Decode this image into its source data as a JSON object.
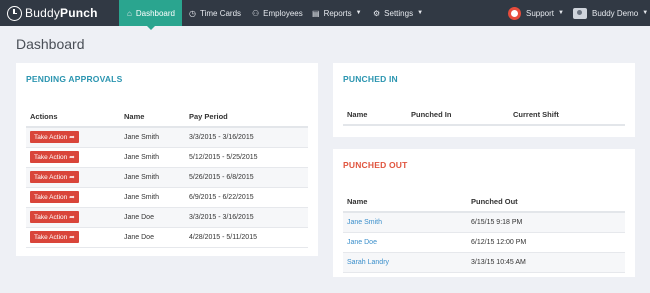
{
  "brand": {
    "part1": "Buddy",
    "part2": "Punch"
  },
  "nav": {
    "dashboard": {
      "icon": "home-icon",
      "label": "Dashboard"
    },
    "timecards": {
      "icon": "clock-icon",
      "label": "Time Cards"
    },
    "employees": {
      "icon": "users-icon",
      "label": "Employees"
    },
    "reports": {
      "icon": "folder-icon",
      "label": "Reports"
    },
    "settings": {
      "icon": "gear-icon",
      "label": "Settings"
    },
    "support": {
      "icon": "lifebuoy-icon",
      "label": "Support"
    },
    "user": {
      "icon": "avatar-icon",
      "label": "Buddy Demo"
    }
  },
  "page_title": "Dashboard",
  "pending": {
    "title": "PENDING APPROVALS",
    "headers": {
      "actions": "Actions",
      "name": "Name",
      "period": "Pay Period"
    },
    "button_label": "Take Action",
    "rows": [
      {
        "name": "Jane Smith",
        "period": "3/3/2015 - 3/16/2015"
      },
      {
        "name": "Jane Smith",
        "period": "5/12/2015 - 5/25/2015"
      },
      {
        "name": "Jane Smith",
        "period": "5/26/2015 - 6/8/2015"
      },
      {
        "name": "Jane Smith",
        "period": "6/9/2015 - 6/22/2015"
      },
      {
        "name": "Jane Doe",
        "period": "3/3/2015 - 3/16/2015"
      },
      {
        "name": "Jane Doe",
        "period": "4/28/2015 - 5/11/2015"
      }
    ]
  },
  "punched_in": {
    "title": "PUNCHED IN",
    "headers": {
      "name": "Name",
      "punched_in": "Punched In",
      "shift": "Current Shift"
    }
  },
  "punched_out": {
    "title": "PUNCHED OUT",
    "headers": {
      "name": "Name",
      "punched_out": "Punched Out"
    },
    "rows": [
      {
        "name": "Jane Smith",
        "time": "6/15/15 9:18 PM"
      },
      {
        "name": "Jane Doe",
        "time": "6/12/15 12:00 PM"
      },
      {
        "name": "Sarah Landry",
        "time": "3/13/15 10:45 AM"
      }
    ]
  },
  "colors": {
    "nav_bg": "#313944",
    "accent": "#2aa58f",
    "teal_title": "#2b95b0",
    "red_title": "#e0553f",
    "button": "#d9453a",
    "link": "#3b8fcb"
  }
}
